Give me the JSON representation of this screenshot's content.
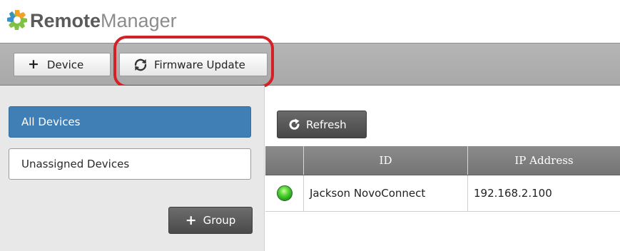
{
  "app": {
    "brand_bold": "Remote",
    "brand_light": "Manager",
    "logo_icon": "gear-logo-icon",
    "brand_colors": {
      "gear_green": "#7fc241",
      "gear_orange": "#f3a024",
      "gear_blue": "#3b8fcb"
    }
  },
  "toolbar": {
    "device_label": "Device",
    "device_icon": "plus-icon",
    "firmware_label": "Firmware Update",
    "firmware_icon": "refresh-arrows-icon",
    "highlight_color": "#d42027"
  },
  "sidebar": {
    "items": [
      {
        "label": "All Devices",
        "selected": true
      },
      {
        "label": "Unassigned Devices",
        "selected": false
      }
    ],
    "group_button_label": "Group",
    "accent_color": "#3f7fb6"
  },
  "main": {
    "refresh_label": "Refresh",
    "refresh_icon": "refresh-icon",
    "table": {
      "columns": [
        "",
        "ID",
        "IP Address"
      ],
      "rows": [
        {
          "status": "online",
          "status_color": "#3cc32c",
          "id": "Jackson NovoConnect",
          "ip": "192.168.2.100"
        }
      ]
    }
  }
}
